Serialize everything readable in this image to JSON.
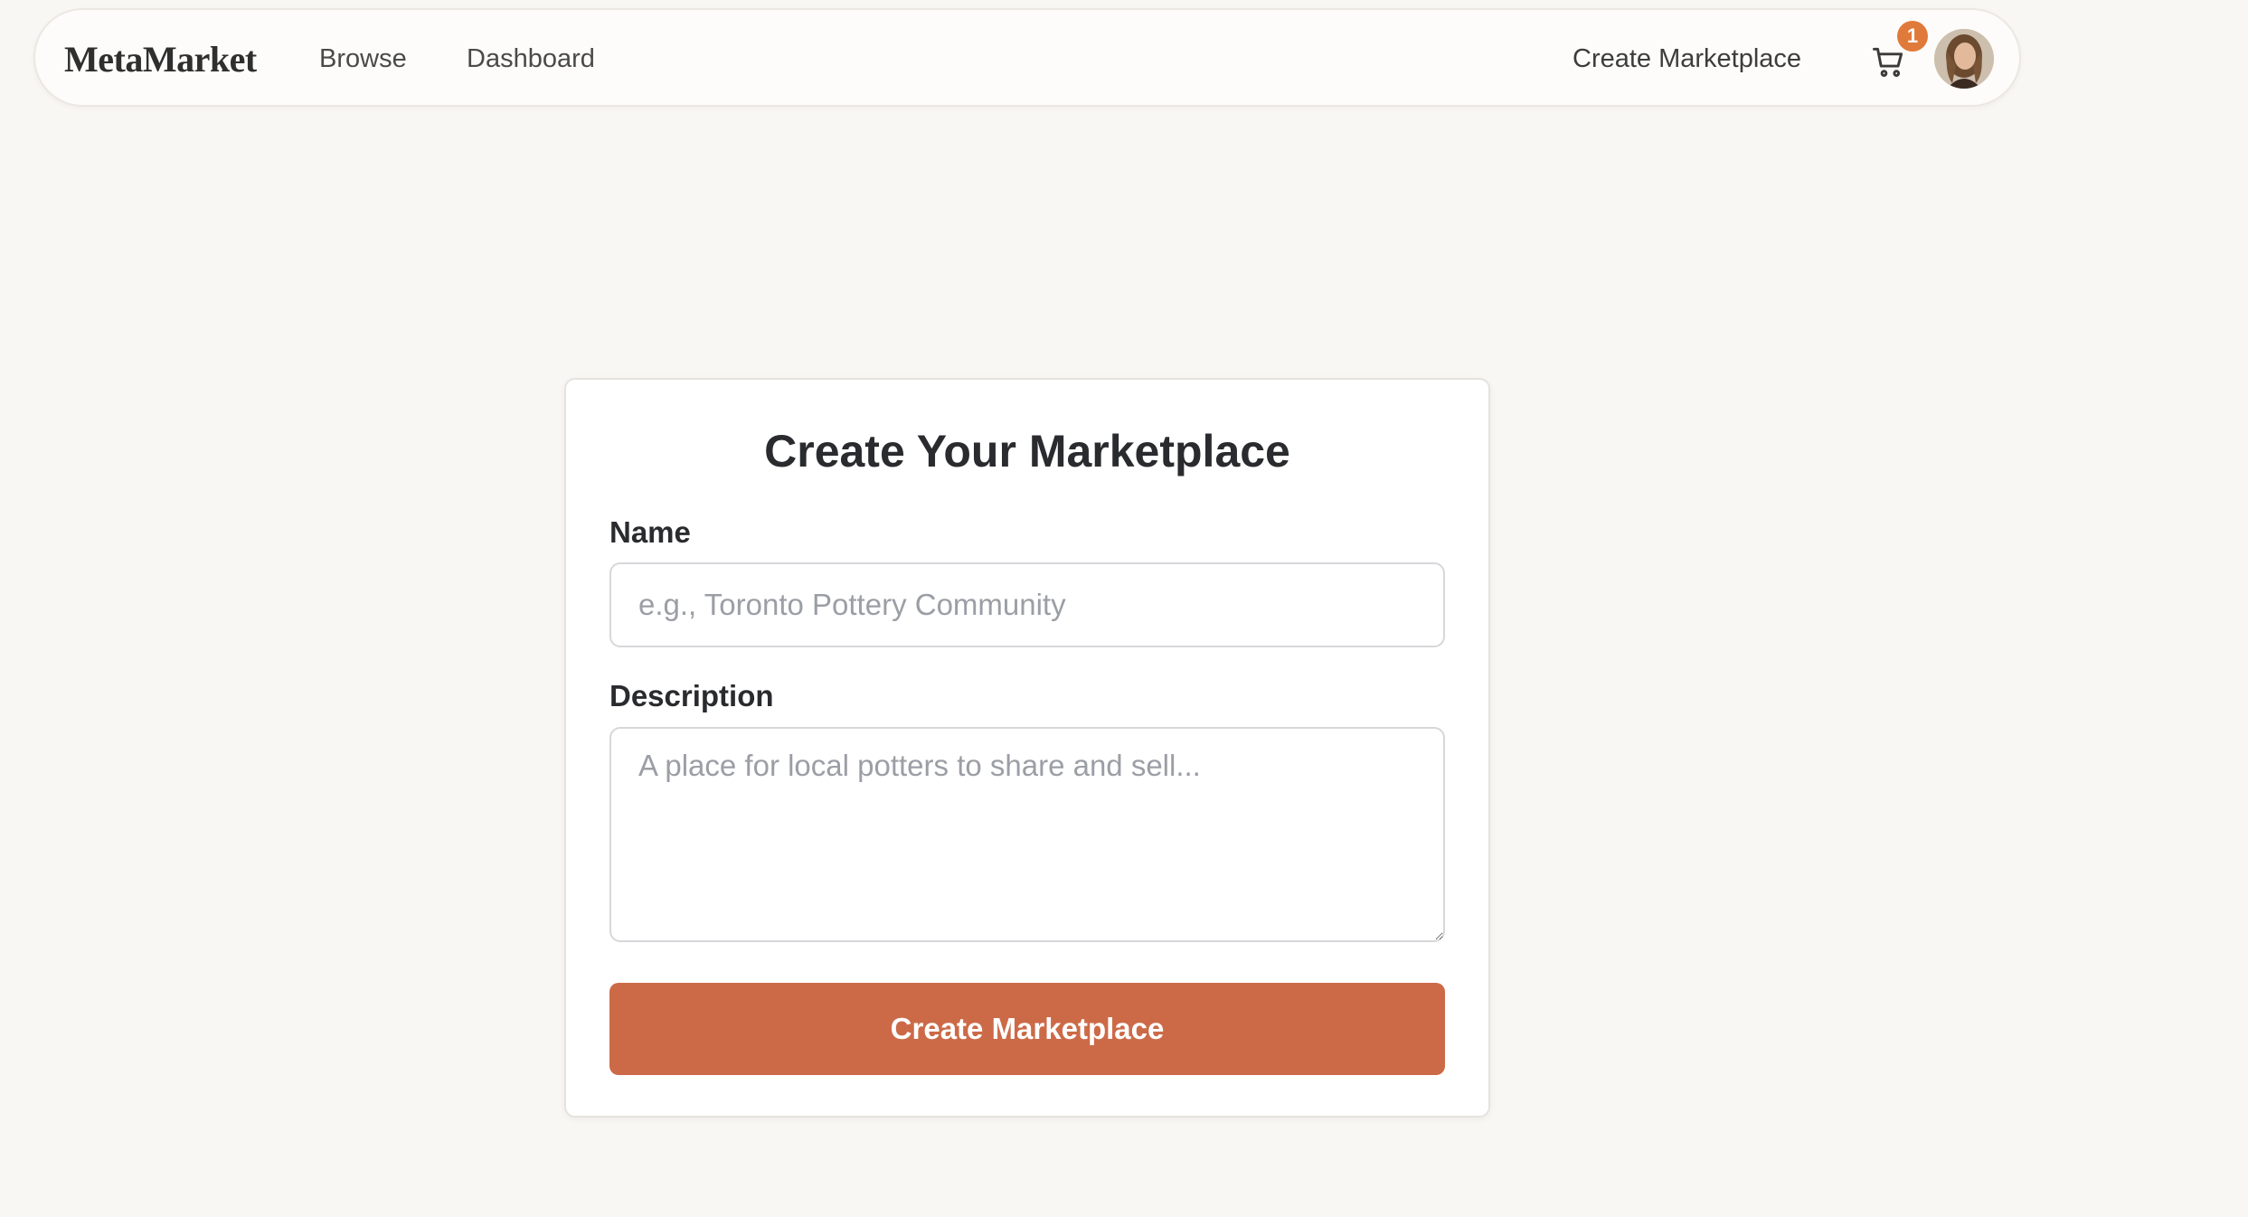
{
  "nav": {
    "brand": "MetaMarket",
    "links": [
      {
        "label": "Browse"
      },
      {
        "label": "Dashboard"
      }
    ],
    "create_link": "Create Marketplace",
    "cart": {
      "icon": "cart-icon",
      "count": "1"
    },
    "avatar": {
      "icon": "user-avatar"
    }
  },
  "form": {
    "title": "Create Your Marketplace",
    "name_label": "Name",
    "name_placeholder": "e.g., Toronto Pottery Community",
    "name_value": "",
    "description_label": "Description",
    "description_placeholder": "A place for local potters to share and sell...",
    "description_value": "",
    "submit_label": "Create Marketplace"
  },
  "colors": {
    "page_background": "#f9f7f3",
    "accent": "#cc6a48",
    "badge": "#e07a3a"
  }
}
